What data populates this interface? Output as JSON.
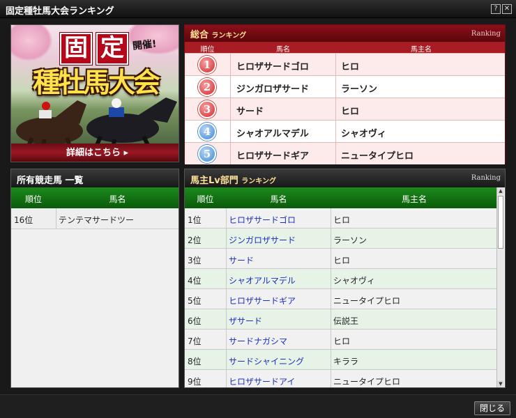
{
  "window": {
    "title": "固定種牡馬大会ランキング",
    "help_label": "?",
    "close_label": "✕"
  },
  "banner": {
    "char_1": "固",
    "char_2": "定",
    "kaisai": "開催!",
    "main_text": "種牡馬大会",
    "detail_link": "詳細はこちら ▸"
  },
  "sogo": {
    "title": "総合",
    "title_small": "ランキング",
    "ranking_label": "Ranking",
    "columns": {
      "rank": "順位",
      "name": "馬名",
      "owner": "馬主名"
    },
    "rows": [
      {
        "rank": "1",
        "medal": "red",
        "name": "ヒロザサードゴロ",
        "owner": "ヒロ"
      },
      {
        "rank": "2",
        "medal": "red",
        "name": "ジンガロザサード",
        "owner": "ラーソン"
      },
      {
        "rank": "3",
        "medal": "red",
        "name": "サード",
        "owner": "ヒロ"
      },
      {
        "rank": "4",
        "medal": "blue",
        "name": "シャオアルマデル",
        "owner": "シャオヴィ"
      },
      {
        "rank": "5",
        "medal": "blue",
        "name": "ヒロザサードギア",
        "owner": "ニュータイプヒロ"
      }
    ]
  },
  "owned": {
    "title": "所有競走馬 一覧",
    "columns": {
      "rank": "順位",
      "name": "馬名"
    },
    "rows": [
      {
        "rank": "16位",
        "name": "テンテマサードツー"
      }
    ]
  },
  "lv": {
    "title": "馬主Lv部門",
    "title_small": "ランキング",
    "ranking_label": "Ranking",
    "columns": {
      "rank": "順位",
      "name": "馬名",
      "owner": "馬主名"
    },
    "rows": [
      {
        "rank": "1位",
        "name": "ヒロザサードゴロ",
        "owner": "ヒロ"
      },
      {
        "rank": "2位",
        "name": "ジンガロザサード",
        "owner": "ラーソン"
      },
      {
        "rank": "3位",
        "name": "サード",
        "owner": "ヒロ"
      },
      {
        "rank": "4位",
        "name": "シャオアルマデル",
        "owner": "シャオヴィ"
      },
      {
        "rank": "5位",
        "name": "ヒロザサードギア",
        "owner": "ニュータイプヒロ"
      },
      {
        "rank": "6位",
        "name": "ザサード",
        "owner": "伝説王"
      },
      {
        "rank": "7位",
        "name": "サードナガシマ",
        "owner": "ヒロ"
      },
      {
        "rank": "8位",
        "name": "サードシャイニング",
        "owner": "キララ"
      },
      {
        "rank": "9位",
        "name": "ヒロザサードアイ",
        "owner": "ニュータイプヒロ"
      }
    ],
    "scroll_up": "▲",
    "scroll_down": "▼"
  },
  "footer": {
    "close_button": "閉じる"
  },
  "colors": {
    "sogo_header": "#8d0f19",
    "green_header": "#1b8a1b",
    "link_blue": "#1a2dbf",
    "medal_red": "#d6242a",
    "medal_blue": "#3a86d6"
  }
}
